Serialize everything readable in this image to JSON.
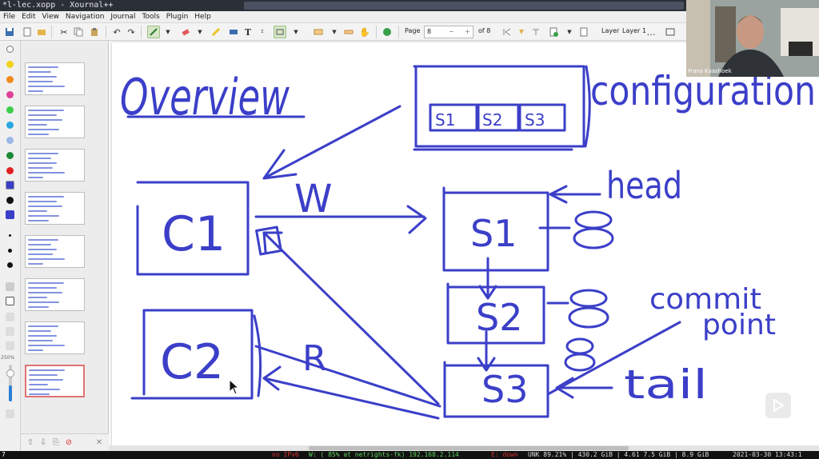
{
  "window": {
    "title": "*l-lec.xopp - Xournal++"
  },
  "menubar": {
    "items": [
      "File",
      "Edit",
      "View",
      "Navigation",
      "Journal",
      "Tools",
      "Plugin",
      "Help"
    ]
  },
  "toolbar": {
    "page_label": "Page",
    "page_value": "8",
    "page_of": "of 8",
    "layer_label": "Layer",
    "layer_value": "Layer 1"
  },
  "sidebar": {
    "zoom_label": "250%",
    "thumb_count": 8,
    "selected_index": 7
  },
  "video": {
    "participant_name": "Frans Kaashoek"
  },
  "drawing": {
    "title": "Overview",
    "configuration_label": "configuration",
    "config_servers": [
      "S1",
      "S2",
      "S3"
    ],
    "client_1": "C1",
    "client_2": "C2",
    "write_label": "W",
    "read_label": "R",
    "server_1": "S1",
    "server_2": "S2",
    "server_3": "S3",
    "head_label": "head",
    "tail_label": "tail",
    "commit_label_1": "commit",
    "commit_label_2": "point",
    "ink_color": "#3b3fc8"
  },
  "statusbar": {
    "left": "7",
    "net": "no IPv6",
    "wifi": "W: ( 85% at netrights-fk) 192.168.2.114",
    "eth": "E: down",
    "stats": "UNK 89.21% | 430.2 GiB | 4.61 7.5 GiB | 8.9 GiB",
    "datetime": "2021-03-30 13:43:1"
  },
  "colors": {
    "titlebar": "#2b2f38",
    "selection_border": "#e07373",
    "ink": "#3b3fc8"
  }
}
